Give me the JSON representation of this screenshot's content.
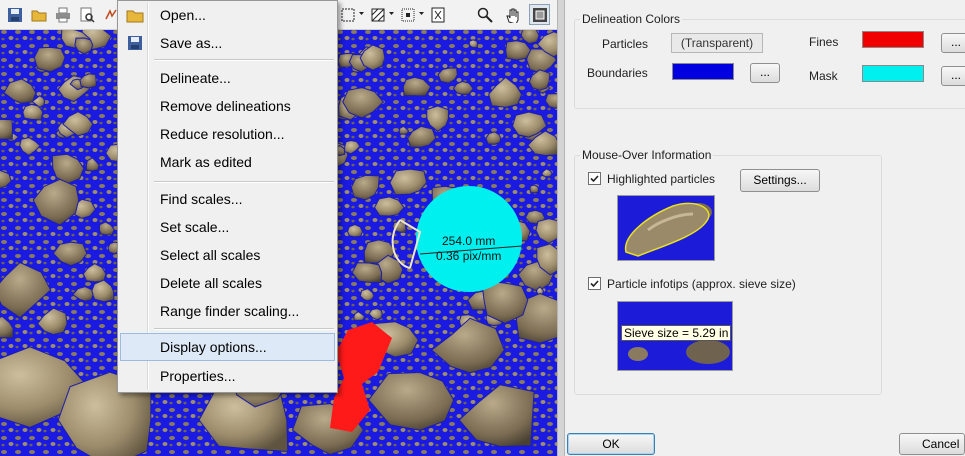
{
  "toolbar": {
    "left_icons": [
      "save-icon",
      "open-folder-icon",
      "print-icon",
      "print-preview-icon"
    ],
    "right_icons": [
      "rectangle-select-icon",
      "hatch-fill-icon",
      "dotted-select-icon",
      "scale-icon",
      "zoom-icon",
      "pan-hand-icon",
      "fit-view-icon"
    ]
  },
  "overlay": {
    "circle_color": "#00f0f0",
    "measure_line1": "254.0 mm",
    "measure_line2": "0.36 pix/mm",
    "fines_color": "#ff1a1a",
    "boundary_color": "#1a1ae0"
  },
  "menu": {
    "items": [
      {
        "label": "Open...",
        "icon": "open-folder-icon"
      },
      {
        "label": "Save as...",
        "icon": "save-icon"
      },
      {
        "label": "Delineate..."
      },
      {
        "label": "Remove delineations"
      },
      {
        "label": "Reduce resolution..."
      },
      {
        "label": "Mark as edited"
      },
      {
        "label": "Find scales..."
      },
      {
        "label": "Set scale..."
      },
      {
        "label": "Select all scales"
      },
      {
        "label": "Delete all scales"
      },
      {
        "label": "Range finder scaling..."
      },
      {
        "label": "Display options...",
        "highlighted": true
      },
      {
        "label": "Properties..."
      }
    ]
  },
  "dialog": {
    "delineation_colors": {
      "title": "Delineation Colors",
      "particles_label": "Particles",
      "particles_value": "(Transparent)",
      "boundaries_label": "Boundaries",
      "boundaries_color": "#0000e0",
      "fines_label": "Fines",
      "fines_color": "#f00000",
      "mask_label": "Mask",
      "mask_color": "#00f0f0",
      "ellipsis": "..."
    },
    "mouse_over": {
      "title": "Mouse-Over Information",
      "highlighted_label": "Highlighted particles",
      "highlighted_checked": true,
      "settings_label": "Settings...",
      "infotips_label": "Particle infotips (approx. sieve size)",
      "infotips_checked": true,
      "tip_text": "Sieve size = 5.29 in",
      "highlight_color": "#e8e020"
    },
    "ok_label": "OK",
    "cancel_label": "Cancel"
  }
}
